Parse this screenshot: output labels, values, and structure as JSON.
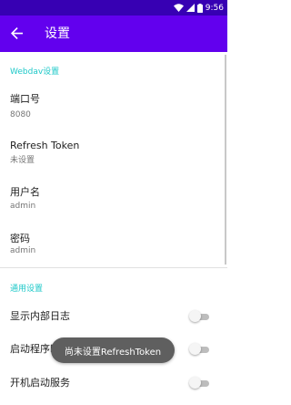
{
  "status_bar": {
    "time": "9:56",
    "icons": [
      "wifi-icon",
      "signal-icon",
      "battery-icon"
    ]
  },
  "app_bar": {
    "title": "设置",
    "back_icon": "arrow-back-icon"
  },
  "sections": {
    "webdav": {
      "header": "Webdav设置",
      "items": [
        {
          "title": "端口号",
          "summary": "8080"
        },
        {
          "title": "Refresh Token",
          "summary": "未设置"
        },
        {
          "title": "用户名",
          "summary": "admin"
        },
        {
          "title": "密码",
          "summary": "admin"
        }
      ]
    },
    "general": {
      "header": "通用设置",
      "items": [
        {
          "title": "显示内部日志",
          "checked": false
        },
        {
          "title": "启动程序时自动启动服务",
          "checked": false
        },
        {
          "title": "开机启动服务",
          "checked": false
        }
      ]
    }
  },
  "toast": {
    "text": "尚未设置RefreshToken"
  },
  "colors": {
    "primary": "#6200ee",
    "primary_dark": "#3700b3",
    "accent": "#1ec8c8"
  }
}
